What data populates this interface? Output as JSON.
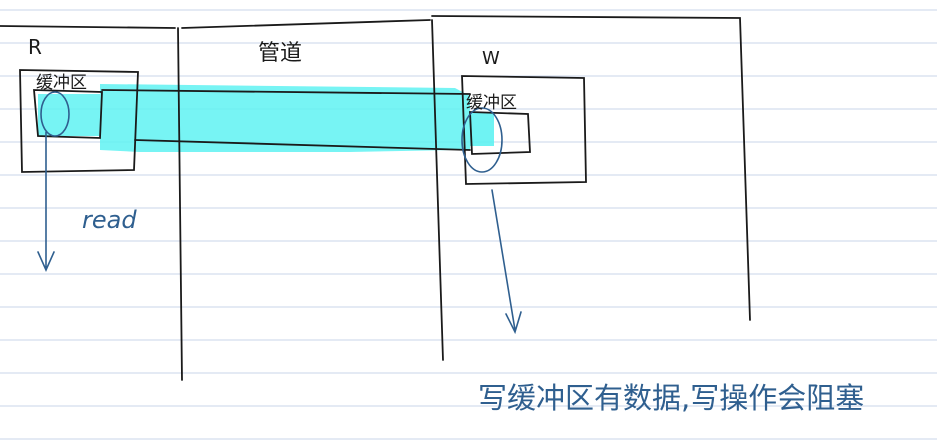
{
  "colors": {
    "paper": "#ffffff",
    "rule_line": "#c9d4ea",
    "ink_black": "#1a1a1a",
    "ink_blue": "#2f5f8f",
    "highlight": "#5ff2f2"
  },
  "labels": {
    "reader_process": "R",
    "writer_process": "W",
    "reader_buffer": "缓冲区",
    "writer_buffer": "缓冲区",
    "pipe_label": "管道",
    "read_label": "read",
    "write_note": "写缓冲区有数据,写操作会阻塞"
  }
}
